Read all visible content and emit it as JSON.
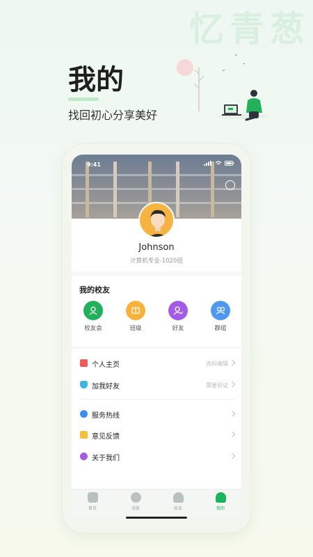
{
  "brand": {
    "watermark": "忆青葱"
  },
  "hero": {
    "title": "我的",
    "subtitle": "找回初心分享美好"
  },
  "status_bar": {
    "time": "9:41"
  },
  "profile": {
    "name": "Johnson",
    "class_info": "计算机专业-1020班"
  },
  "alumni": {
    "title": "我的校友",
    "items": [
      {
        "label": "校友会",
        "color": "#22b15a",
        "icon": "alumni-association-icon"
      },
      {
        "label": "班级",
        "color": "#f6b23a",
        "icon": "class-icon"
      },
      {
        "label": "好友",
        "color": "#a45ce6",
        "icon": "friend-icon"
      },
      {
        "label": "群组",
        "color": "#4f98ef",
        "icon": "group-icon"
      }
    ]
  },
  "menu_primary": [
    {
      "label": "个人主页",
      "hint": "资料编辑",
      "icon": "profile-card-icon",
      "color": "#f05a5a"
    },
    {
      "label": "加我好友",
      "hint": "需要验证",
      "icon": "shield-check-icon",
      "color": "#3fb6e0"
    }
  ],
  "menu_secondary": [
    {
      "label": "服务热线",
      "icon": "phone-icon",
      "color": "#3e8ef0"
    },
    {
      "label": "意见反馈",
      "icon": "feedback-icon",
      "color": "#f5c13a"
    },
    {
      "label": "关于我们",
      "icon": "info-icon",
      "color": "#a45ce6"
    }
  ],
  "tabbar": {
    "items": [
      {
        "label": "首页",
        "icon": "home-icon"
      },
      {
        "label": "消息",
        "icon": "message-icon"
      },
      {
        "label": "校友",
        "icon": "alumni-icon"
      },
      {
        "label": "我的",
        "icon": "me-icon",
        "active": true
      }
    ],
    "active_color": "#1bb45a"
  }
}
